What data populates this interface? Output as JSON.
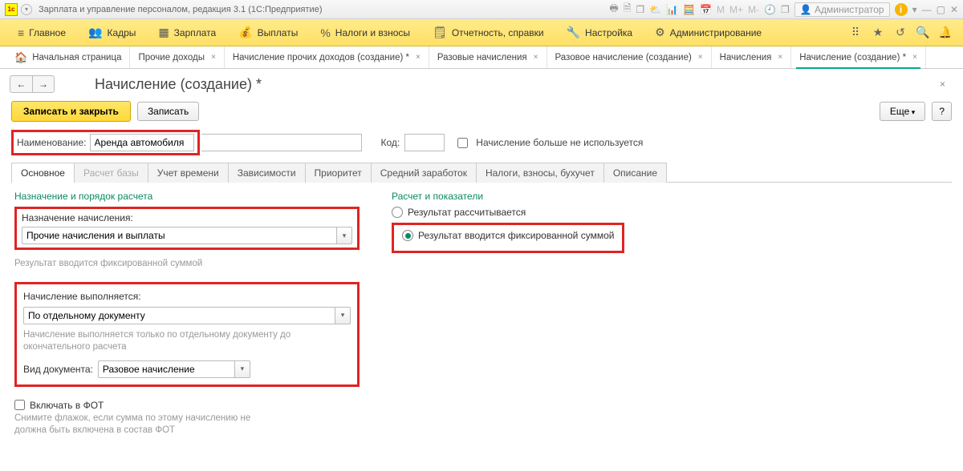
{
  "titlebar": {
    "appTitle": "Зарплата и управление персоналом, редакция 3.1  (1С:Предприятие)",
    "admin": "Администратор"
  },
  "mainnav": {
    "items": [
      "Главное",
      "Кадры",
      "Зарплата",
      "Выплаты",
      "Налоги и взносы",
      "Отчетность, справки",
      "Настройка",
      "Администрирование"
    ]
  },
  "tabs": {
    "home": "Начальная страница",
    "items": [
      "Прочие доходы",
      "Начисление прочих доходов (создание) *",
      "Разовые начисления",
      "Разовое начисление (создание)",
      "Начисления",
      "Начисление (создание) *"
    ]
  },
  "page": {
    "title": "Начисление (создание) *",
    "saveClose": "Записать и закрыть",
    "save": "Записать",
    "more": "Еще",
    "q": "?"
  },
  "form": {
    "nameLabel": "Наименование:",
    "nameValue": "Аренда автомобиля",
    "codeLabel": "Код:",
    "codeValue": "",
    "unusedLabel": "Начисление больше не используется"
  },
  "subtabs": [
    "Основное",
    "Расчет базы",
    "Учет времени",
    "Зависимости",
    "Приоритет",
    "Средний заработок",
    "Налоги, взносы, бухучет",
    "Описание"
  ],
  "sec1": {
    "title": "Назначение и порядок расчета",
    "assignLabel": "Назначение начисления:",
    "assignValue": "Прочие начисления и выплаты",
    "assignHint": "Результат вводится фиксированной суммой",
    "execLabel": "Начисление выполняется:",
    "execValue": "По отдельному документу",
    "execHint": "Начисление выполняется только по отдельному документу до окончательного расчета",
    "docLabel": "Вид документа:",
    "docValue": "Разовое начисление"
  },
  "sec2": {
    "title": "Расчет и показатели",
    "r1": "Результат рассчитывается",
    "r2": "Результат вводится фиксированной суммой"
  },
  "fot": {
    "chk": "Включать в ФОТ",
    "hint": "Снимите флажок, если сумма по этому начислению не должна быть включена в состав ФОТ"
  }
}
